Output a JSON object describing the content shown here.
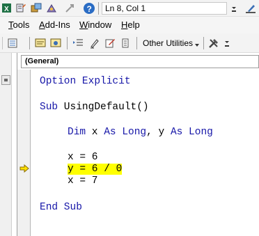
{
  "toolbar": {
    "status": "Ln 8, Col 1",
    "other_utilities": "Other Utilities"
  },
  "menu": {
    "tools": {
      "underline": "T",
      "rest": "ools"
    },
    "addins": {
      "underline": "A",
      "rest": "dd-Ins"
    },
    "window": {
      "underline": "W",
      "rest": "indow"
    },
    "help": {
      "underline": "H",
      "rest": "elp"
    }
  },
  "code": {
    "procedure_combo": "(General)",
    "lines": [
      {
        "keyword": "Option Explicit",
        "rest": ""
      },
      {
        "keyword": "Sub",
        "rest": " UsingDefault()"
      },
      {
        "keyword": "Dim",
        "mid1": " x ",
        "kw2": "As Long",
        "mid2": ", y ",
        "kw3": "As Long"
      },
      {
        "text": "x = 6"
      },
      {
        "text": "y = 6 / 0",
        "highlighted": true
      },
      {
        "text": "x = 7"
      },
      {
        "keyword": "End Sub",
        "rest": ""
      }
    ]
  },
  "colors": {
    "keyword": "#1616a8",
    "highlight": "#ffff00",
    "exec_arrow": "#ffe000"
  }
}
